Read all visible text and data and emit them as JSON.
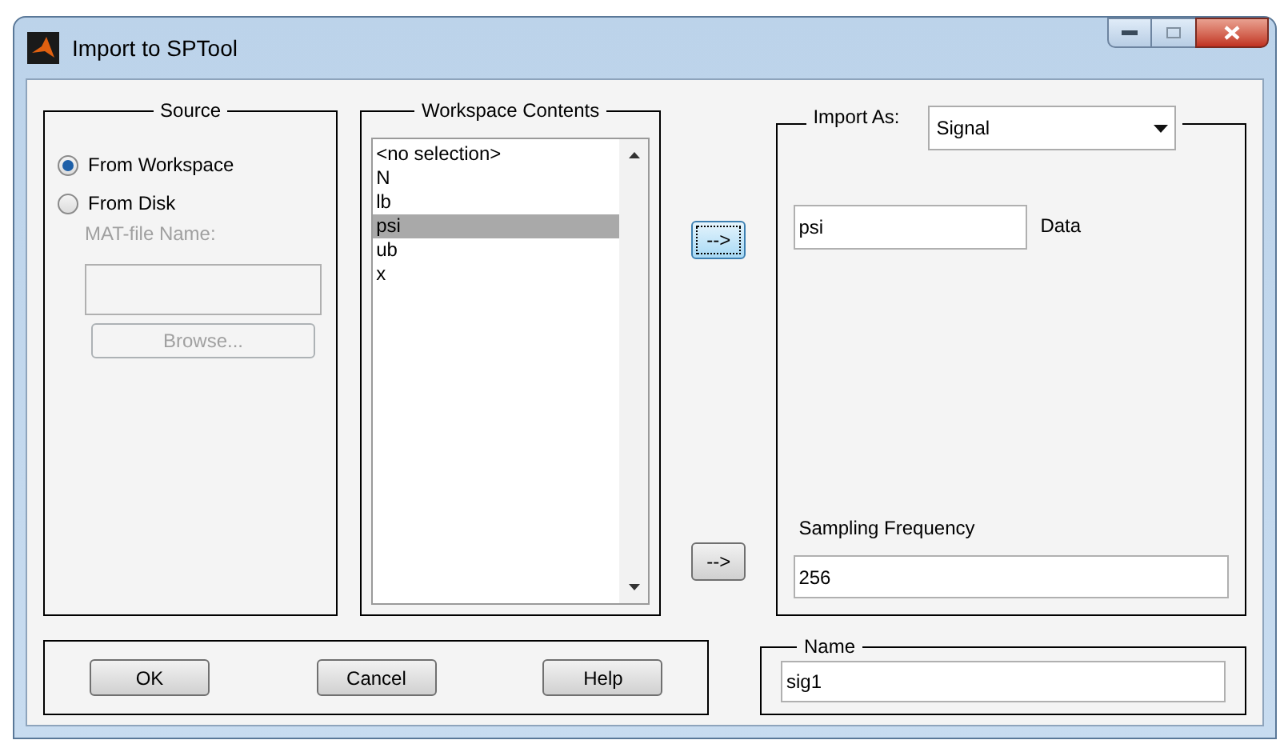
{
  "window": {
    "title": "Import to SPTool"
  },
  "source": {
    "legend": "Source",
    "options": [
      {
        "label": "From Workspace",
        "selected": true
      },
      {
        "label": "From Disk",
        "selected": false
      }
    ],
    "file_label": "MAT-file Name:",
    "file_field": {
      "disabled": true
    },
    "browse": {
      "label": "Browse...",
      "disabled": true
    }
  },
  "workspace": {
    "legend": "Workspace Contents",
    "items": [
      {
        "label": "<no selection>",
        "selected": false
      },
      {
        "label": "N",
        "selected": false
      },
      {
        "label": "lb",
        "selected": false
      },
      {
        "label": "psi",
        "selected": true
      },
      {
        "label": "ub",
        "selected": false
      },
      {
        "label": "x",
        "selected": false
      }
    ]
  },
  "arrow_buttons": [
    {
      "label": "-->",
      "focused": true
    },
    {
      "label": "-->",
      "focused": false
    }
  ],
  "import_as": {
    "label": "Import As:",
    "value": "Signal"
  },
  "data_field": {
    "value": "psi",
    "label": "Data"
  },
  "sampling": {
    "label": "Sampling Frequency",
    "value": "256"
  },
  "name": {
    "legend": "Name",
    "value": "sig1"
  },
  "buttons": [
    "OK",
    "Cancel",
    "Help"
  ]
}
